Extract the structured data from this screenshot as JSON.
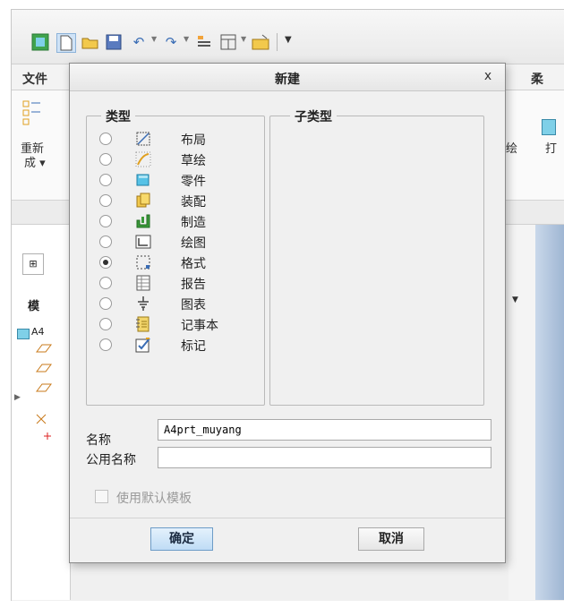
{
  "background": {
    "menu_tabs": [
      "文件",
      "柔"
    ],
    "ribbon_labels": [
      "重新",
      "成 ▾",
      "绘",
      "打"
    ],
    "model_tree_label": "模",
    "model_tree_item": "A4"
  },
  "dialog": {
    "title": "新建",
    "close_glyph": "x",
    "type_group": {
      "legend": "类型",
      "items": [
        {
          "label": "布局",
          "icon": "layout-icon",
          "checked": false
        },
        {
          "label": "草绘",
          "icon": "sketch-icon",
          "checked": false
        },
        {
          "label": "零件",
          "icon": "part-icon",
          "checked": false
        },
        {
          "label": "装配",
          "icon": "assembly-icon",
          "checked": false
        },
        {
          "label": "制造",
          "icon": "manufacturing-icon",
          "checked": false
        },
        {
          "label": "绘图",
          "icon": "drawing-icon",
          "checked": false
        },
        {
          "label": "格式",
          "icon": "format-icon",
          "checked": true
        },
        {
          "label": "报告",
          "icon": "report-icon",
          "checked": false
        },
        {
          "label": "图表",
          "icon": "diagram-icon",
          "checked": false
        },
        {
          "label": "记事本",
          "icon": "notebook-icon",
          "checked": false
        },
        {
          "label": "标记",
          "icon": "markup-icon",
          "checked": false
        }
      ]
    },
    "subtype_group": {
      "legend": "子类型"
    },
    "name": {
      "label": "名称",
      "value": "A4prt_muyang"
    },
    "common_name": {
      "label": "公用名称",
      "value": ""
    },
    "use_default_template": {
      "label": "使用默认模板",
      "checked": false,
      "enabled": false
    },
    "ok_label": "确定",
    "cancel_label": "取消"
  },
  "colors": {
    "accent": "#bfdcf5",
    "accent_border": "#6d9cc7"
  }
}
